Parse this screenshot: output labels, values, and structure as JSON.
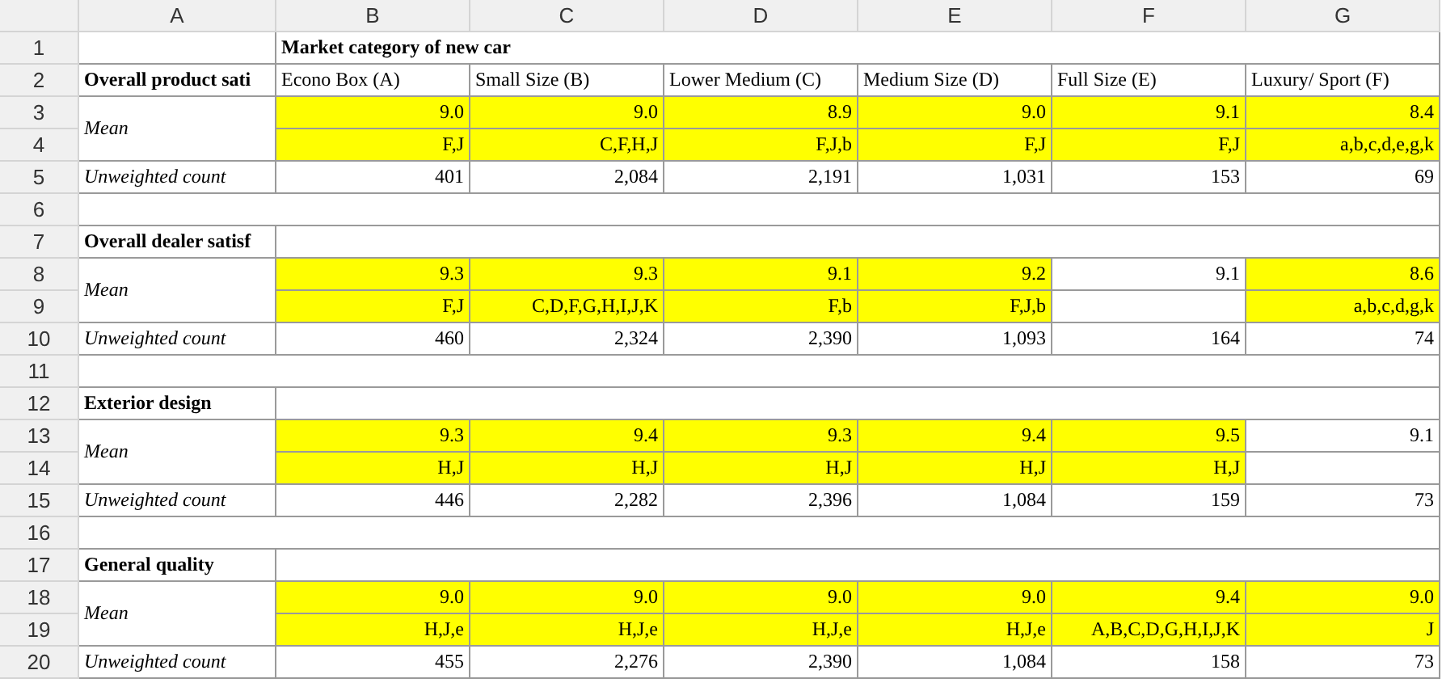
{
  "column_headers": [
    "A",
    "B",
    "C",
    "D",
    "E",
    "F",
    "G"
  ],
  "row_numbers": [
    "1",
    "2",
    "3",
    "4",
    "5",
    "6",
    "7",
    "8",
    "9",
    "10",
    "11",
    "12",
    "13",
    "14",
    "15",
    "16",
    "17",
    "18",
    "19",
    "20"
  ],
  "table_title": "Market category of new car",
  "categories": [
    "Econo Box (A)",
    "Small Size (B)",
    "Lower Medium (C)",
    "Medium Size (D)",
    "Full Size (E)",
    "Luxury/ Sport (F)"
  ],
  "sections": [
    {
      "title": "Overall product sati",
      "mean_label": "Mean",
      "count_label": "Unweighted count",
      "cells": [
        {
          "mean": "9.0",
          "letters": "F,J",
          "count": "401",
          "highlighted": true
        },
        {
          "mean": "9.0",
          "letters": "C,F,H,J",
          "count": "2,084",
          "highlighted": true
        },
        {
          "mean": "8.9",
          "letters": "F,J,b",
          "count": "2,191",
          "highlighted": true
        },
        {
          "mean": "9.0",
          "letters": "F,J",
          "count": "1,031",
          "highlighted": true
        },
        {
          "mean": "9.1",
          "letters": "F,J",
          "count": "153",
          "highlighted": true
        },
        {
          "mean": "8.4",
          "letters": "a,b,c,d,e,g,k",
          "count": "69",
          "highlighted": true
        }
      ]
    },
    {
      "title": "Overall dealer satisf",
      "mean_label": "Mean",
      "count_label": "Unweighted count",
      "cells": [
        {
          "mean": "9.3",
          "letters": "F,J",
          "count": "460",
          "highlighted": true
        },
        {
          "mean": "9.3",
          "letters": "C,D,F,G,H,I,J,K",
          "count": "2,324",
          "highlighted": true
        },
        {
          "mean": "9.1",
          "letters": "F,b",
          "count": "2,390",
          "highlighted": true
        },
        {
          "mean": "9.2",
          "letters": "F,J,b",
          "count": "1,093",
          "highlighted": true
        },
        {
          "mean": "9.1",
          "count": "164",
          "highlighted": false
        },
        {
          "mean": "8.6",
          "letters": "a,b,c,d,g,k",
          "count": "74",
          "highlighted": true
        }
      ]
    },
    {
      "title": "Exterior design",
      "mean_label": "Mean",
      "count_label": "Unweighted count",
      "cells": [
        {
          "mean": "9.3",
          "letters": "H,J",
          "count": "446",
          "highlighted": true
        },
        {
          "mean": "9.4",
          "letters": "H,J",
          "count": "2,282",
          "highlighted": true
        },
        {
          "mean": "9.3",
          "letters": "H,J",
          "count": "2,396",
          "highlighted": true
        },
        {
          "mean": "9.4",
          "letters": "H,J",
          "count": "1,084",
          "highlighted": true
        },
        {
          "mean": "9.5",
          "letters": "H,J",
          "count": "159",
          "highlighted": true
        },
        {
          "mean": "9.1",
          "count": "73",
          "highlighted": false
        }
      ]
    },
    {
      "title": "General quality",
      "mean_label": "Mean",
      "count_label": "Unweighted count",
      "cells": [
        {
          "mean": "9.0",
          "letters": "H,J,e",
          "count": "455",
          "highlighted": true
        },
        {
          "mean": "9.0",
          "letters": "H,J,e",
          "count": "2,276",
          "highlighted": true
        },
        {
          "mean": "9.0",
          "letters": "H,J,e",
          "count": "2,390",
          "highlighted": true
        },
        {
          "mean": "9.0",
          "letters": "H,J,e",
          "count": "1,084",
          "highlighted": true
        },
        {
          "mean": "9.4",
          "letters": "A,B,C,D,G,H,I,J,K",
          "count": "158",
          "highlighted": true
        },
        {
          "mean": "9.0",
          "letters": "J",
          "count": "73",
          "highlighted": true
        }
      ]
    }
  ]
}
